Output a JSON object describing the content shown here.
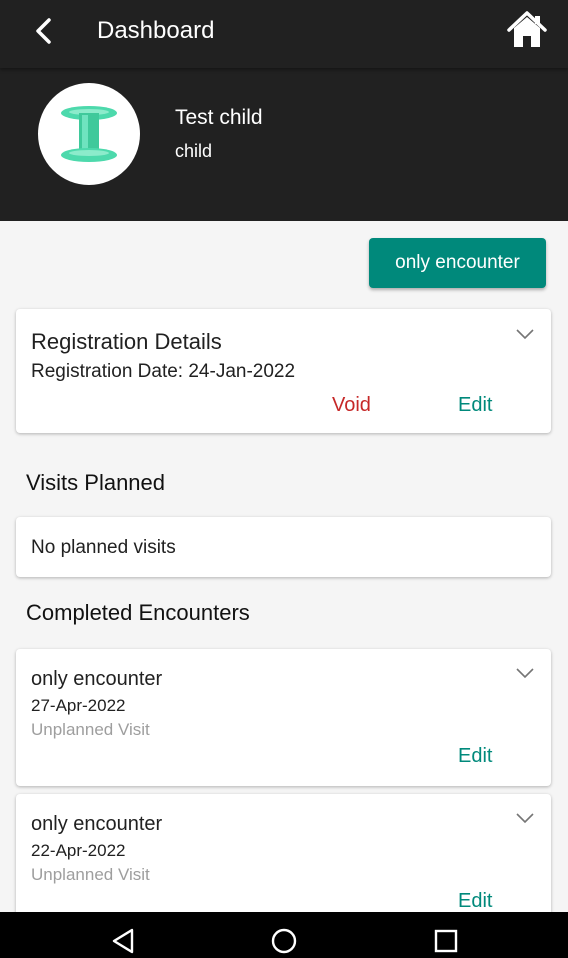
{
  "appbar": {
    "back_icon": "chevron-left-icon",
    "title": "Dashboard",
    "home_icon": "home-icon"
  },
  "profile": {
    "avatar_icon": "individual-icon",
    "name": "Test child",
    "subject_type": "child"
  },
  "actions": {
    "new_encounter_label": "only encounter"
  },
  "registration": {
    "title": "Registration Details",
    "date_line": "Registration Date: 24-Jan-2022",
    "void_label": "Void",
    "edit_label": "Edit"
  },
  "visits_planned": {
    "heading": "Visits Planned",
    "empty_text": "No planned visits"
  },
  "completed": {
    "heading": "Completed Encounters",
    "encounters": [
      {
        "name": "only encounter",
        "date": "27-Apr-2022",
        "type": "Unplanned Visit",
        "edit_label": "Edit"
      },
      {
        "name": "only encounter",
        "date": "22-Apr-2022",
        "type": "Unplanned Visit",
        "edit_label": "Edit"
      }
    ]
  },
  "system_nav": {
    "back_icon": "triangle-back-icon",
    "home_icon": "circle-home-icon",
    "recents_icon": "square-recents-icon"
  },
  "colors": {
    "appbar_bg": "#212121",
    "accent": "#00897b",
    "void": "#c62828",
    "avatar_icon": "#4dd9ac"
  }
}
